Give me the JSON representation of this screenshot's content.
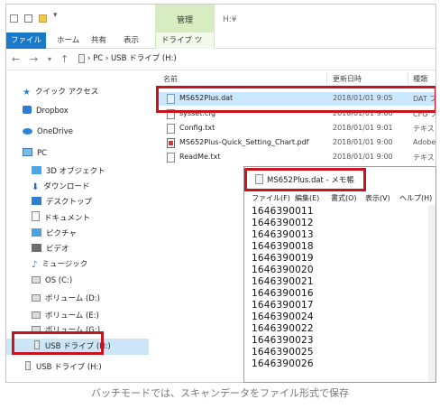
{
  "window": {
    "title": "H:¥"
  },
  "ribbon": {
    "context_tab": "管理",
    "tabs": [
      {
        "label": "ファイル"
      },
      {
        "label": "ホーム"
      },
      {
        "label": "共有"
      },
      {
        "label": "表示"
      },
      {
        "label": "ドライブ ツール"
      }
    ]
  },
  "address": {
    "path": "› PC › USB ドライブ (H:)"
  },
  "nav": {
    "items": [
      {
        "label": "クイック アクセス",
        "icon": "star-icon"
      },
      {
        "label": "Dropbox",
        "icon": "dropbox-icon"
      },
      {
        "label": "OneDrive",
        "icon": "onedrive-icon"
      },
      {
        "label": "PC",
        "icon": "pc-icon"
      },
      {
        "label": "3D オブジェクト",
        "icon": "folder-icon"
      },
      {
        "label": "ダウンロード",
        "icon": "download-icon"
      },
      {
        "label": "デスクトップ",
        "icon": "desktop-icon"
      },
      {
        "label": "ドキュメント",
        "icon": "document-icon"
      },
      {
        "label": "ピクチャ",
        "icon": "picture-icon"
      },
      {
        "label": "ビデオ",
        "icon": "video-icon"
      },
      {
        "label": "ミュージック",
        "icon": "music-icon"
      },
      {
        "label": "OS (C:)",
        "icon": "drive-icon"
      },
      {
        "label": "ボリューム (D:)",
        "icon": "drive-icon"
      },
      {
        "label": "ボリューム (E:)",
        "icon": "drive-icon"
      },
      {
        "label": "ボリューム (G:)",
        "icon": "drive-icon"
      },
      {
        "label": "USB ドライブ (H:)",
        "icon": "usb-drive-icon"
      },
      {
        "label": "USB ドライブ (H:)",
        "icon": "usb-drive-icon"
      }
    ]
  },
  "files": {
    "columns": [
      "名前",
      "更新日時",
      "種類"
    ],
    "rows": [
      {
        "name": "MS652Plus.dat",
        "date": "2018/01/01 9:05",
        "type": "DAT ファ"
      },
      {
        "name": "sysset.cfg",
        "date": "2018/01/01 9:00",
        "type": "CFG ファ"
      },
      {
        "name": "Config.txt",
        "date": "2018/01/01 9:01",
        "type": "テキスト"
      },
      {
        "name": "MS652Plus-Quick_Setting_Chart.pdf",
        "date": "2018/01/01 9:00",
        "type": "Adobe..."
      },
      {
        "name": "ReadMe.txt",
        "date": "2018/01/01 9:00",
        "type": "テキスト"
      }
    ]
  },
  "notepad": {
    "title": "MS652Plus.dat - メモ帳",
    "menu": [
      "ファイル(F)",
      "編集(E)",
      "書式(O)",
      "表示(V)",
      "ヘルプ(H)"
    ],
    "lines": [
      "1646390011",
      "1646390012",
      "1646390013",
      "1646390018",
      "1646390019",
      "1646390020",
      "1646390021",
      "1646390016",
      "1646390017",
      "1646390024",
      "1646390022",
      "1646390023",
      "1646390025",
      "1646390026"
    ]
  },
  "caption": "バッチモードでは、スキャンデータをファイル形式で保存",
  "colors": {
    "highlight": "#c8141e",
    "file_tab": "#1979ca",
    "context_tab": "#d7ecc1"
  }
}
